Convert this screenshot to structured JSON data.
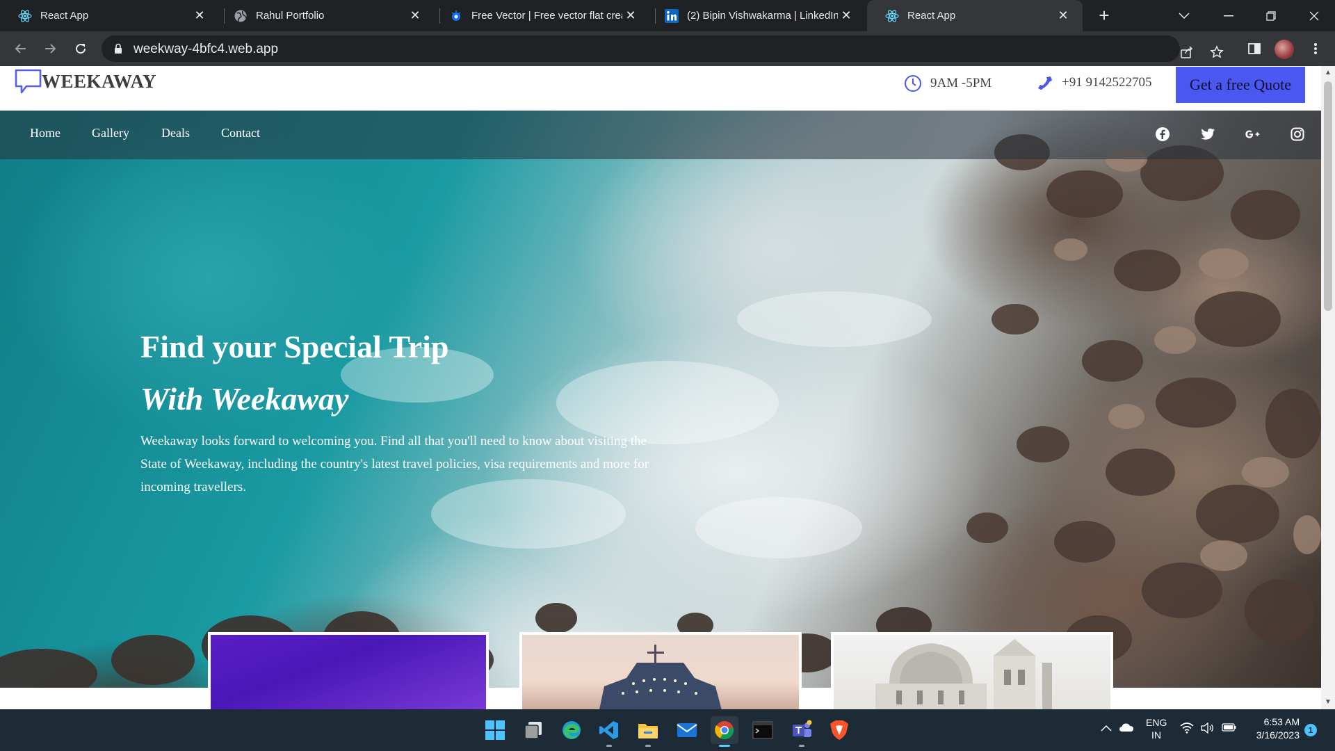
{
  "browser": {
    "tabs": [
      {
        "title": "React App",
        "icon": "react-icon",
        "active": false
      },
      {
        "title": "Rahul Portfolio",
        "icon": "globe-icon",
        "active": false
      },
      {
        "title": "Free Vector | Free vector flat creati",
        "icon": "freepik-icon",
        "active": false
      },
      {
        "title": "(2) Bipin Vishwakarma | LinkedIn",
        "icon": "linkedin-icon",
        "active": false
      },
      {
        "title": "React App",
        "icon": "react-icon",
        "active": true
      }
    ],
    "url": "weekway-4bfc4.web.app"
  },
  "site": {
    "logo_text": "WEEKAWAY",
    "hours": "9AM -5PM",
    "phone": "+91 9142522705",
    "quote_button": "Get a free Quote",
    "nav": [
      "Home",
      "Gallery",
      "Deals",
      "Contact"
    ],
    "social": [
      "facebook-icon",
      "twitter-icon",
      "google-plus-icon",
      "instagram-icon"
    ],
    "hero": {
      "title": "Find your Special Trip",
      "subtitle": "With Weekaway",
      "description": "Weekaway looks forward to welcoming you. Find all that you'll need to know about visiting the State of Weekaway, including the country's latest travel policies, visa requirements and more for incoming travellers."
    }
  },
  "taskbar": {
    "language_line1": "ENG",
    "language_line2": "IN",
    "time": "6:53 AM",
    "date": "3/16/2023",
    "notification_count": "1"
  }
}
